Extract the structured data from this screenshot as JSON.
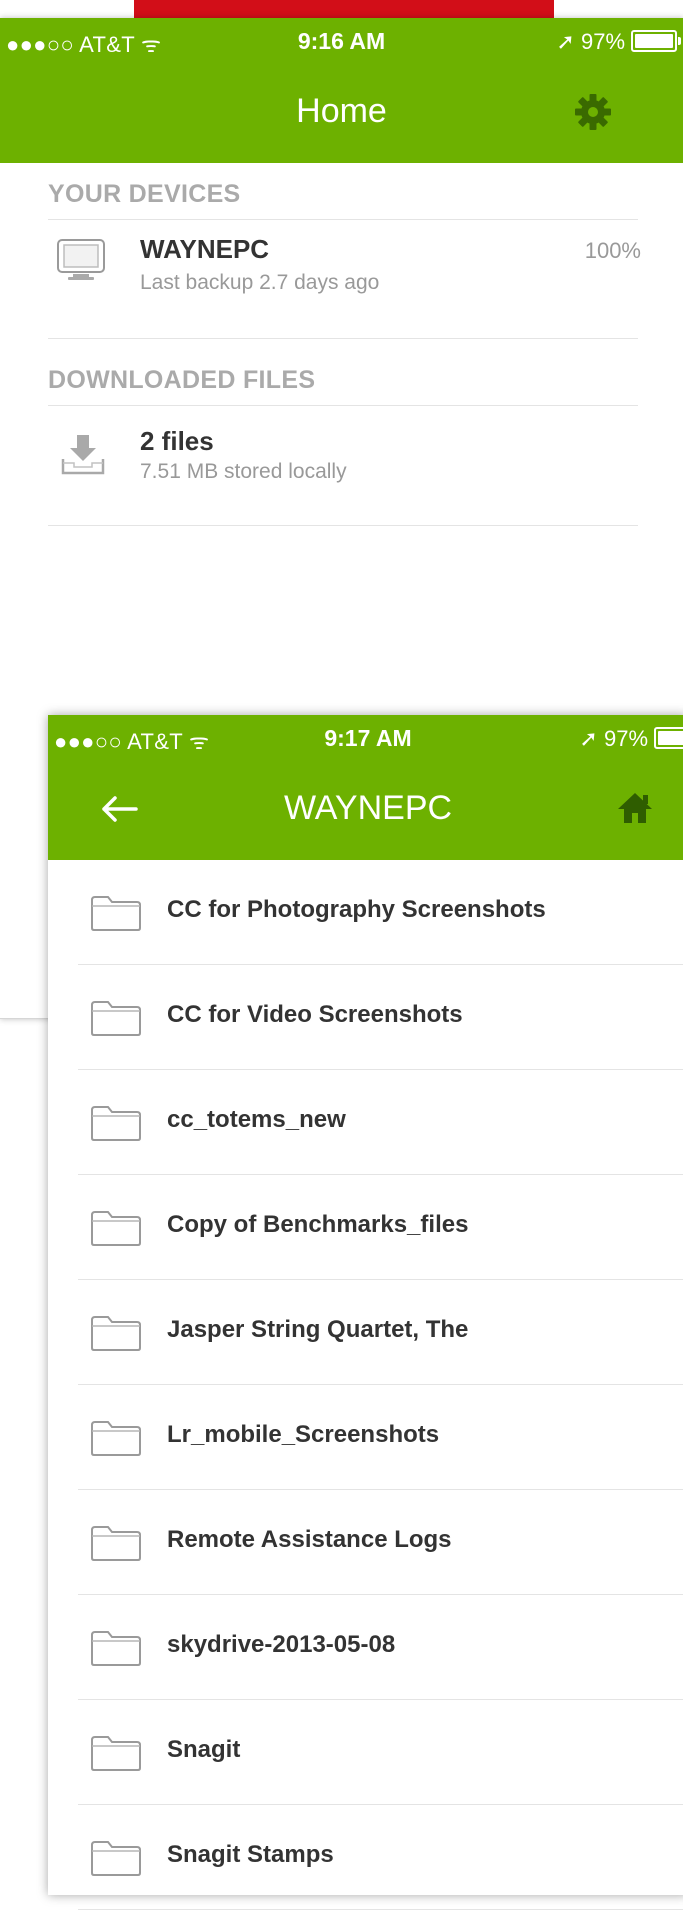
{
  "home": {
    "status": {
      "carrier": "●●●○○ AT&T ᯤ",
      "time": "9:16 AM",
      "location_battery": "➚ 97%"
    },
    "title": "Home",
    "sections": {
      "devices_header": "YOUR DEVICES",
      "device": {
        "name": "WAYNEPC",
        "subtitle": "Last backup 2.7 days ago",
        "percent": "100%"
      },
      "downloads_header": "DOWNLOADED FILES",
      "downloads": {
        "title": "2 files",
        "subtitle": "7.51 MB stored locally"
      }
    }
  },
  "device_view": {
    "status": {
      "carrier": "●●●○○ AT&T ᯤ",
      "time": "9:17 AM",
      "location_battery": "➚ 97%"
    },
    "title": "WAYNEPC",
    "folders": [
      "CC for Photography Screenshots",
      "CC for Video Screenshots",
      "cc_totems_new",
      "Copy of Benchmarks_files",
      "Jasper String Quartet, The",
      "Lr_mobile_Screenshots",
      "Remote Assistance Logs",
      "skydrive-2013-05-08",
      "Snagit",
      "Snagit Stamps"
    ]
  },
  "colors": {
    "header_green": "#6db100",
    "accent_red": "#d20e18"
  },
  "icons": {
    "settings": "gear-icon",
    "back": "arrow-left-icon",
    "home": "home-icon",
    "device": "monitor-icon",
    "downloads": "download-tray-icon",
    "folder": "folder-icon"
  }
}
